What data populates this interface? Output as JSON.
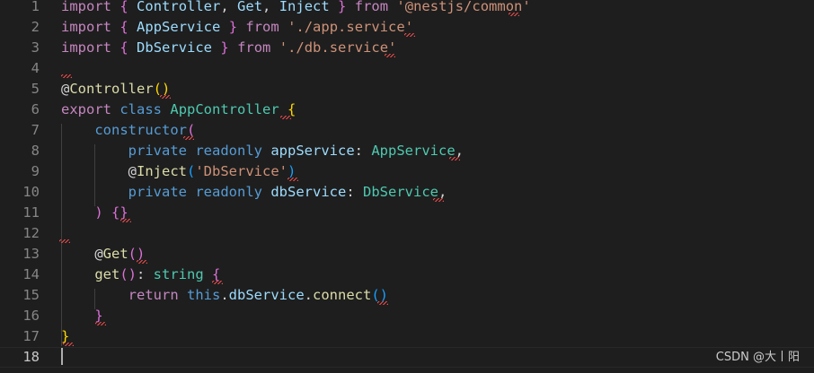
{
  "colors": {
    "background": "#1e1e1e",
    "keyword_blue": "#569cd6",
    "keyword_purple": "#c586c0",
    "type_teal": "#4ec9b0",
    "string_orange": "#ce9178",
    "function_yellow": "#dcdcaa",
    "variable_lightblue": "#9cdcfe",
    "plain_text": "#d4d4d4",
    "bracket_gold": "#ffd700",
    "bracket_purple": "#da70d6",
    "bracket_blue": "#179fff",
    "line_number": "#858585",
    "error_squiggle": "#f14c4c"
  },
  "lines": [
    {
      "number": "1",
      "tokens": [
        {
          "text": "import",
          "color": "#c586c0"
        },
        {
          "text": " "
        },
        {
          "text": "{",
          "color": "#da70d6"
        },
        {
          "text": " "
        },
        {
          "text": "Controller",
          "color": "#9cdcfe"
        },
        {
          "text": ", "
        },
        {
          "text": "Get",
          "color": "#9cdcfe"
        },
        {
          "text": ", "
        },
        {
          "text": "Inject",
          "color": "#9cdcfe"
        },
        {
          "text": " "
        },
        {
          "text": "}",
          "color": "#da70d6"
        },
        {
          "text": " "
        },
        {
          "text": "from",
          "color": "#c586c0"
        },
        {
          "text": " "
        },
        {
          "text": "'@nestjs/common'",
          "color": "#ce9178"
        }
      ]
    },
    {
      "number": "2",
      "tokens": [
        {
          "text": "import",
          "color": "#c586c0"
        },
        {
          "text": " "
        },
        {
          "text": "{",
          "color": "#da70d6"
        },
        {
          "text": " "
        },
        {
          "text": "AppService",
          "color": "#9cdcfe"
        },
        {
          "text": " "
        },
        {
          "text": "}",
          "color": "#da70d6"
        },
        {
          "text": " "
        },
        {
          "text": "from",
          "color": "#c586c0"
        },
        {
          "text": " "
        },
        {
          "text": "'./app.service'",
          "color": "#ce9178"
        }
      ]
    },
    {
      "number": "3",
      "tokens": [
        {
          "text": "import",
          "color": "#c586c0"
        },
        {
          "text": " "
        },
        {
          "text": "{",
          "color": "#da70d6"
        },
        {
          "text": " "
        },
        {
          "text": "DbService",
          "color": "#9cdcfe"
        },
        {
          "text": " "
        },
        {
          "text": "}",
          "color": "#da70d6"
        },
        {
          "text": " "
        },
        {
          "text": "from",
          "color": "#c586c0"
        },
        {
          "text": " "
        },
        {
          "text": "'./db.service'",
          "color": "#ce9178"
        }
      ]
    },
    {
      "number": "4",
      "tokens": []
    },
    {
      "number": "5",
      "tokens": [
        {
          "text": "@",
          "color": "#d4d4d4"
        },
        {
          "text": "Controller",
          "color": "#dcdcaa"
        },
        {
          "text": "()",
          "color": "#ffd700"
        }
      ]
    },
    {
      "number": "6",
      "tokens": [
        {
          "text": "export",
          "color": "#c586c0"
        },
        {
          "text": " "
        },
        {
          "text": "class",
          "color": "#569cd6"
        },
        {
          "text": " "
        },
        {
          "text": "AppController",
          "color": "#4ec9b0"
        },
        {
          "text": " "
        },
        {
          "text": "{",
          "color": "#ffd700"
        }
      ]
    },
    {
      "number": "7",
      "tokens": [
        {
          "text": "    "
        },
        {
          "text": "constructor",
          "color": "#569cd6"
        },
        {
          "text": "(",
          "color": "#da70d6"
        }
      ]
    },
    {
      "number": "8",
      "tokens": [
        {
          "text": "        "
        },
        {
          "text": "private",
          "color": "#569cd6"
        },
        {
          "text": " "
        },
        {
          "text": "readonly",
          "color": "#569cd6"
        },
        {
          "text": " "
        },
        {
          "text": "appService",
          "color": "#9cdcfe"
        },
        {
          "text": ": "
        },
        {
          "text": "AppService",
          "color": "#4ec9b0"
        },
        {
          "text": ","
        }
      ]
    },
    {
      "number": "9",
      "tokens": [
        {
          "text": "        "
        },
        {
          "text": "@"
        },
        {
          "text": "Inject",
          "color": "#dcdcaa"
        },
        {
          "text": "(",
          "color": "#179fff"
        },
        {
          "text": "'DbService'",
          "color": "#ce9178"
        },
        {
          "text": ")",
          "color": "#179fff"
        }
      ]
    },
    {
      "number": "10",
      "tokens": [
        {
          "text": "        "
        },
        {
          "text": "private",
          "color": "#569cd6"
        },
        {
          "text": " "
        },
        {
          "text": "readonly",
          "color": "#569cd6"
        },
        {
          "text": " "
        },
        {
          "text": "dbService",
          "color": "#9cdcfe"
        },
        {
          "text": ": "
        },
        {
          "text": "DbService",
          "color": "#4ec9b0"
        },
        {
          "text": ","
        }
      ]
    },
    {
      "number": "11",
      "tokens": [
        {
          "text": "    "
        },
        {
          "text": ")",
          "color": "#da70d6"
        },
        {
          "text": " "
        },
        {
          "text": "{}",
          "color": "#da70d6"
        }
      ]
    },
    {
      "number": "12",
      "tokens": []
    },
    {
      "number": "13",
      "tokens": [
        {
          "text": "    "
        },
        {
          "text": "@"
        },
        {
          "text": "Get",
          "color": "#dcdcaa"
        },
        {
          "text": "()",
          "color": "#da70d6"
        }
      ]
    },
    {
      "number": "14",
      "tokens": [
        {
          "text": "    "
        },
        {
          "text": "get",
          "color": "#dcdcaa"
        },
        {
          "text": "()",
          "color": "#da70d6"
        },
        {
          "text": ": "
        },
        {
          "text": "string",
          "color": "#4ec9b0"
        },
        {
          "text": " "
        },
        {
          "text": "{",
          "color": "#da70d6"
        }
      ]
    },
    {
      "number": "15",
      "tokens": [
        {
          "text": "        "
        },
        {
          "text": "return",
          "color": "#c586c0"
        },
        {
          "text": " "
        },
        {
          "text": "this",
          "color": "#569cd6"
        },
        {
          "text": "."
        },
        {
          "text": "dbService",
          "color": "#9cdcfe"
        },
        {
          "text": "."
        },
        {
          "text": "connect",
          "color": "#dcdcaa"
        },
        {
          "text": "()",
          "color": "#179fff"
        }
      ]
    },
    {
      "number": "16",
      "tokens": [
        {
          "text": "    "
        },
        {
          "text": "}",
          "color": "#da70d6"
        }
      ]
    },
    {
      "number": "17",
      "tokens": [
        {
          "text": "}",
          "color": "#ffd700"
        }
      ]
    },
    {
      "number": "18",
      "tokens": []
    }
  ],
  "watermark": "CSDN @大丨阳"
}
